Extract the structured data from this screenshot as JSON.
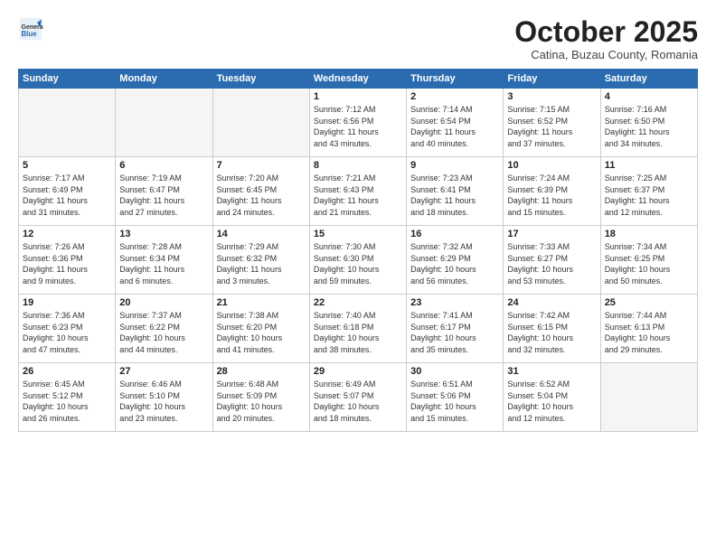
{
  "header": {
    "logo_line1": "General",
    "logo_line2": "Blue",
    "month": "October 2025",
    "location": "Catina, Buzau County, Romania"
  },
  "weekdays": [
    "Sunday",
    "Monday",
    "Tuesday",
    "Wednesday",
    "Thursday",
    "Friday",
    "Saturday"
  ],
  "weeks": [
    [
      {
        "day": "",
        "info": ""
      },
      {
        "day": "",
        "info": ""
      },
      {
        "day": "",
        "info": ""
      },
      {
        "day": "1",
        "info": "Sunrise: 7:12 AM\nSunset: 6:56 PM\nDaylight: 11 hours\nand 43 minutes."
      },
      {
        "day": "2",
        "info": "Sunrise: 7:14 AM\nSunset: 6:54 PM\nDaylight: 11 hours\nand 40 minutes."
      },
      {
        "day": "3",
        "info": "Sunrise: 7:15 AM\nSunset: 6:52 PM\nDaylight: 11 hours\nand 37 minutes."
      },
      {
        "day": "4",
        "info": "Sunrise: 7:16 AM\nSunset: 6:50 PM\nDaylight: 11 hours\nand 34 minutes."
      }
    ],
    [
      {
        "day": "5",
        "info": "Sunrise: 7:17 AM\nSunset: 6:49 PM\nDaylight: 11 hours\nand 31 minutes."
      },
      {
        "day": "6",
        "info": "Sunrise: 7:19 AM\nSunset: 6:47 PM\nDaylight: 11 hours\nand 27 minutes."
      },
      {
        "day": "7",
        "info": "Sunrise: 7:20 AM\nSunset: 6:45 PM\nDaylight: 11 hours\nand 24 minutes."
      },
      {
        "day": "8",
        "info": "Sunrise: 7:21 AM\nSunset: 6:43 PM\nDaylight: 11 hours\nand 21 minutes."
      },
      {
        "day": "9",
        "info": "Sunrise: 7:23 AM\nSunset: 6:41 PM\nDaylight: 11 hours\nand 18 minutes."
      },
      {
        "day": "10",
        "info": "Sunrise: 7:24 AM\nSunset: 6:39 PM\nDaylight: 11 hours\nand 15 minutes."
      },
      {
        "day": "11",
        "info": "Sunrise: 7:25 AM\nSunset: 6:37 PM\nDaylight: 11 hours\nand 12 minutes."
      }
    ],
    [
      {
        "day": "12",
        "info": "Sunrise: 7:26 AM\nSunset: 6:36 PM\nDaylight: 11 hours\nand 9 minutes."
      },
      {
        "day": "13",
        "info": "Sunrise: 7:28 AM\nSunset: 6:34 PM\nDaylight: 11 hours\nand 6 minutes."
      },
      {
        "day": "14",
        "info": "Sunrise: 7:29 AM\nSunset: 6:32 PM\nDaylight: 11 hours\nand 3 minutes."
      },
      {
        "day": "15",
        "info": "Sunrise: 7:30 AM\nSunset: 6:30 PM\nDaylight: 10 hours\nand 59 minutes."
      },
      {
        "day": "16",
        "info": "Sunrise: 7:32 AM\nSunset: 6:29 PM\nDaylight: 10 hours\nand 56 minutes."
      },
      {
        "day": "17",
        "info": "Sunrise: 7:33 AM\nSunset: 6:27 PM\nDaylight: 10 hours\nand 53 minutes."
      },
      {
        "day": "18",
        "info": "Sunrise: 7:34 AM\nSunset: 6:25 PM\nDaylight: 10 hours\nand 50 minutes."
      }
    ],
    [
      {
        "day": "19",
        "info": "Sunrise: 7:36 AM\nSunset: 6:23 PM\nDaylight: 10 hours\nand 47 minutes."
      },
      {
        "day": "20",
        "info": "Sunrise: 7:37 AM\nSunset: 6:22 PM\nDaylight: 10 hours\nand 44 minutes."
      },
      {
        "day": "21",
        "info": "Sunrise: 7:38 AM\nSunset: 6:20 PM\nDaylight: 10 hours\nand 41 minutes."
      },
      {
        "day": "22",
        "info": "Sunrise: 7:40 AM\nSunset: 6:18 PM\nDaylight: 10 hours\nand 38 minutes."
      },
      {
        "day": "23",
        "info": "Sunrise: 7:41 AM\nSunset: 6:17 PM\nDaylight: 10 hours\nand 35 minutes."
      },
      {
        "day": "24",
        "info": "Sunrise: 7:42 AM\nSunset: 6:15 PM\nDaylight: 10 hours\nand 32 minutes."
      },
      {
        "day": "25",
        "info": "Sunrise: 7:44 AM\nSunset: 6:13 PM\nDaylight: 10 hours\nand 29 minutes."
      }
    ],
    [
      {
        "day": "26",
        "info": "Sunrise: 6:45 AM\nSunset: 5:12 PM\nDaylight: 10 hours\nand 26 minutes."
      },
      {
        "day": "27",
        "info": "Sunrise: 6:46 AM\nSunset: 5:10 PM\nDaylight: 10 hours\nand 23 minutes."
      },
      {
        "day": "28",
        "info": "Sunrise: 6:48 AM\nSunset: 5:09 PM\nDaylight: 10 hours\nand 20 minutes."
      },
      {
        "day": "29",
        "info": "Sunrise: 6:49 AM\nSunset: 5:07 PM\nDaylight: 10 hours\nand 18 minutes."
      },
      {
        "day": "30",
        "info": "Sunrise: 6:51 AM\nSunset: 5:06 PM\nDaylight: 10 hours\nand 15 minutes."
      },
      {
        "day": "31",
        "info": "Sunrise: 6:52 AM\nSunset: 5:04 PM\nDaylight: 10 hours\nand 12 minutes."
      },
      {
        "day": "",
        "info": ""
      }
    ]
  ]
}
